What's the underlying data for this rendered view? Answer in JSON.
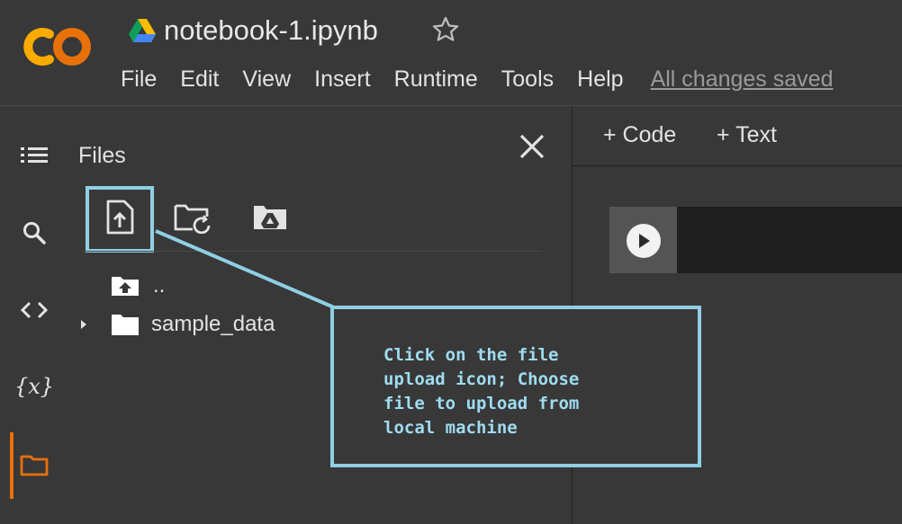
{
  "header": {
    "notebook_title": "notebook-1.ipynb",
    "logo_icon": "colab-logo",
    "drive_icon": "google-drive-icon",
    "star_icon": "star-outline-icon",
    "menu": [
      "File",
      "Edit",
      "View",
      "Insert",
      "Runtime",
      "Tools",
      "Help"
    ],
    "save_status": "All changes saved"
  },
  "rail": {
    "items": [
      {
        "icon": "table-of-contents-icon"
      },
      {
        "icon": "search-icon"
      },
      {
        "icon": "code-snippets-icon"
      },
      {
        "icon": "variables-icon",
        "label": "{x}"
      },
      {
        "icon": "folder-icon",
        "active": true
      }
    ],
    "accent_color": "#e8710a"
  },
  "files_panel": {
    "title": "Files",
    "toolbar": [
      {
        "icon": "upload-file-icon",
        "highlighted": true
      },
      {
        "icon": "refresh-folder-icon"
      },
      {
        "icon": "mount-drive-icon"
      }
    ],
    "tree": [
      {
        "label": "..",
        "icon": "folder-up-icon"
      },
      {
        "label": "sample_data",
        "icon": "folder-icon",
        "expandable": true
      }
    ]
  },
  "notebook": {
    "add_code": "+ Code",
    "add_text": "+ Text",
    "run_icon": "play-circle-icon"
  },
  "callout": {
    "text": "Click on the file\nupload icon; Choose\nfile to upload from\nlocal machine",
    "color": "#90cfe3"
  }
}
